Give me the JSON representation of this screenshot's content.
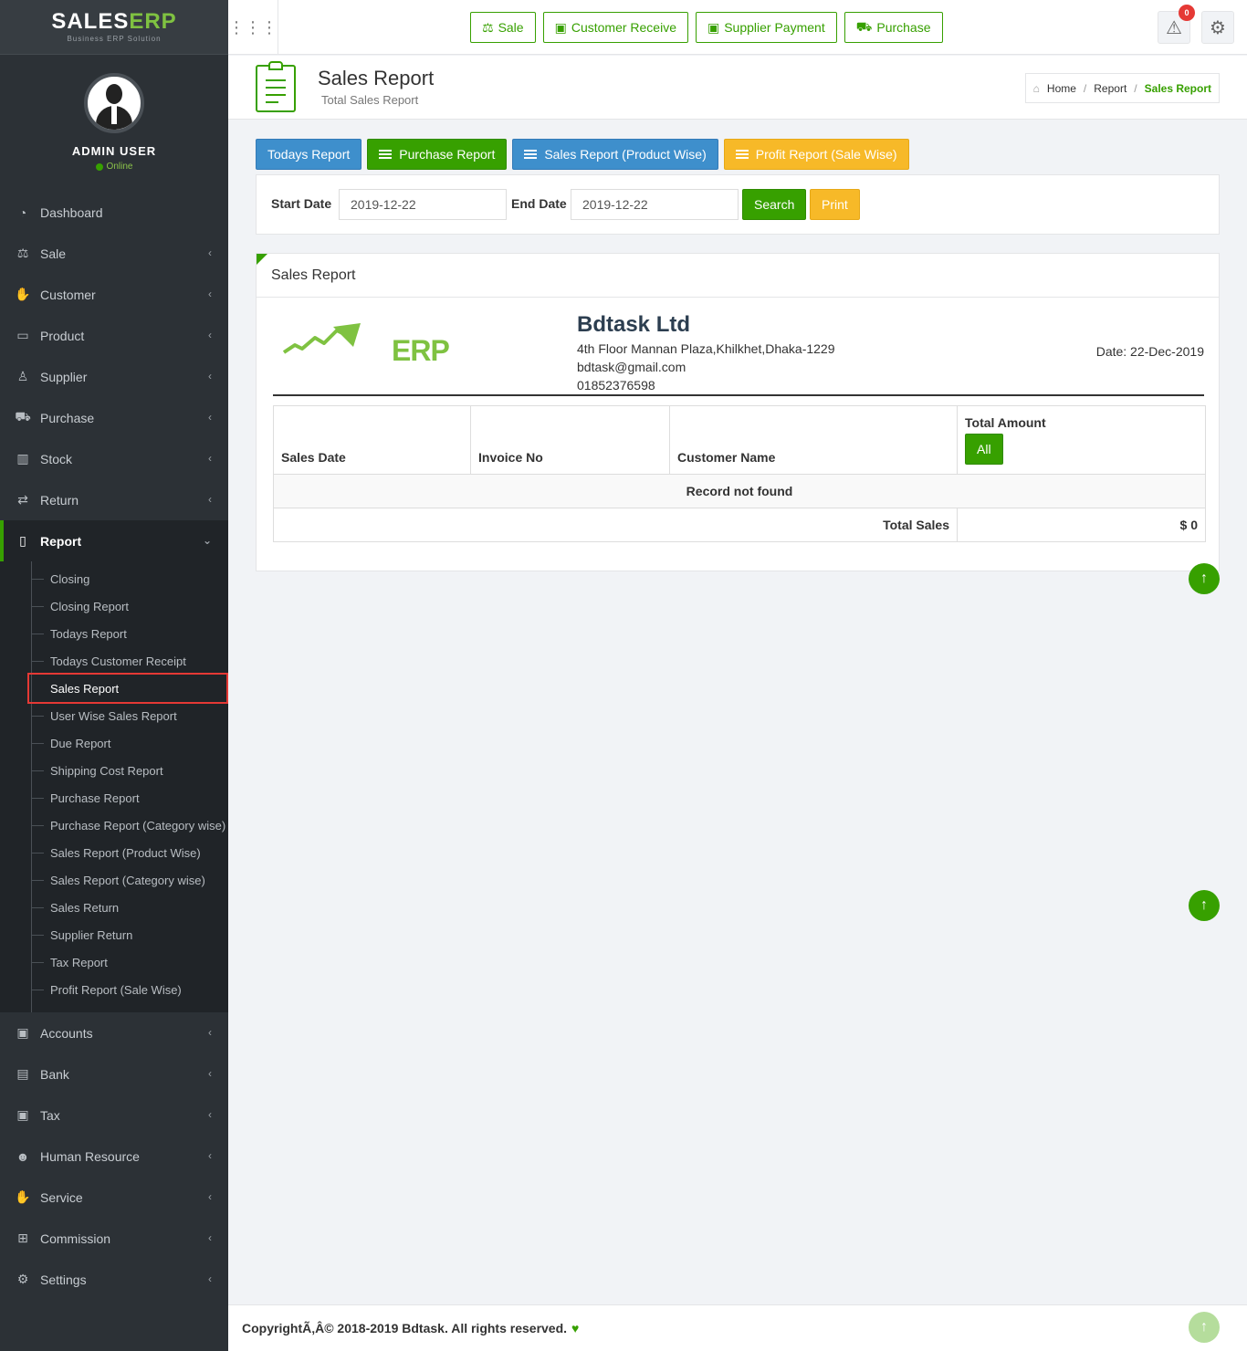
{
  "brand": {
    "logo_main": "SALES",
    "logo_accent": "ERP",
    "tagline": "Business ERP Solution"
  },
  "user": {
    "name": "ADMIN USER",
    "status": "Online"
  },
  "sidebar": {
    "items_top": [
      {
        "label": "Dashboard",
        "icon": "dashboard-icon",
        "glyph": "◔"
      },
      {
        "label": "Sale",
        "icon": "balance-scale-icon",
        "glyph": "⚖"
      },
      {
        "label": "Customer",
        "icon": "handshake-icon",
        "glyph": "✋"
      },
      {
        "label": "Product",
        "icon": "briefcase-icon",
        "glyph": "▭"
      },
      {
        "label": "Supplier",
        "icon": "user-icon",
        "glyph": "♙"
      },
      {
        "label": "Purchase",
        "icon": "cart-icon",
        "glyph": "⛟"
      },
      {
        "label": "Stock",
        "icon": "bar-chart-icon",
        "glyph": "▥"
      },
      {
        "label": "Return",
        "icon": "retweet-icon",
        "glyph": "⇄"
      }
    ],
    "report": {
      "label": "Report",
      "icon": "book-icon",
      "glyph": "▯"
    },
    "report_items": [
      "Closing",
      "Closing Report",
      "Todays Report",
      "Todays Customer Receipt",
      "Sales Report",
      "User Wise Sales Report",
      "Due Report",
      "Shipping Cost Report",
      "Purchase Report",
      "Purchase Report (Category wise)",
      "Sales Report (Product Wise)",
      "Sales Report (Category wise)",
      "Sales Return",
      "Supplier Return",
      "Tax Report",
      "Profit Report (Sale Wise)"
    ],
    "items_bottom": [
      {
        "label": "Accounts",
        "icon": "money-icon",
        "glyph": "▣"
      },
      {
        "label": "Bank",
        "icon": "bank-icon",
        "glyph": "▤"
      },
      {
        "label": "Tax",
        "icon": "money-icon",
        "glyph": "▣"
      },
      {
        "label": "Human Resource",
        "icon": "users-icon",
        "glyph": "☻"
      },
      {
        "label": "Service",
        "icon": "handshake-icon",
        "glyph": "✋"
      },
      {
        "label": "Commission",
        "icon": "grid-icon",
        "glyph": "⊞"
      },
      {
        "label": "Settings",
        "icon": "gear-icon",
        "glyph": "⚙"
      }
    ]
  },
  "topbar": {
    "buttons": [
      {
        "label": "Sale",
        "icon": "balance-scale-icon",
        "glyph": "⚖"
      },
      {
        "label": "Customer Receive",
        "icon": "money-icon",
        "glyph": "▣"
      },
      {
        "label": "Supplier Payment",
        "icon": "money-icon",
        "glyph": "▣"
      },
      {
        "label": "Purchase",
        "icon": "cart-icon",
        "glyph": "⛟"
      }
    ],
    "notification_count": "0"
  },
  "page_header": {
    "title": "Sales Report",
    "subtitle": "Total Sales Report",
    "breadcrumb": {
      "home": "Home",
      "parent": "Report",
      "current": "Sales Report"
    }
  },
  "report_buttons": {
    "todays": "Todays Report",
    "purchase": "Purchase Report",
    "product_wise": "Sales Report (Product Wise)",
    "profit": "Profit Report (Sale Wise)"
  },
  "filter": {
    "start_label": "Start Date",
    "start_value": "2019-12-22",
    "end_label": "End Date",
    "end_value": "2019-12-22",
    "search": "Search",
    "print": "Print"
  },
  "report": {
    "panel_title": "Sales Report",
    "company": {
      "name": "Bdtask Ltd",
      "address": "4th Floor Mannan Plaza,Khilkhet,Dhaka-1229",
      "email": "bdtask@gmail.com",
      "phone": "01852376598",
      "logo_text": "ERP"
    },
    "date": "Date: 22-Dec-2019",
    "columns": [
      "Sales Date",
      "Invoice No",
      "Customer Name",
      "Total Amount"
    ],
    "all_button": "All",
    "empty_message": "Record not found",
    "total_label": "Total Sales",
    "total_value": "$ 0"
  },
  "footer": {
    "text": "CopyrightÃ‚Â© 2018-2019 Bdtask. All rights reserved."
  },
  "colors": {
    "accent": "#37a000",
    "sidebar": "#2c3136",
    "blue": "#3e8fcc",
    "orange": "#f7b928",
    "alert": "#e53935"
  }
}
